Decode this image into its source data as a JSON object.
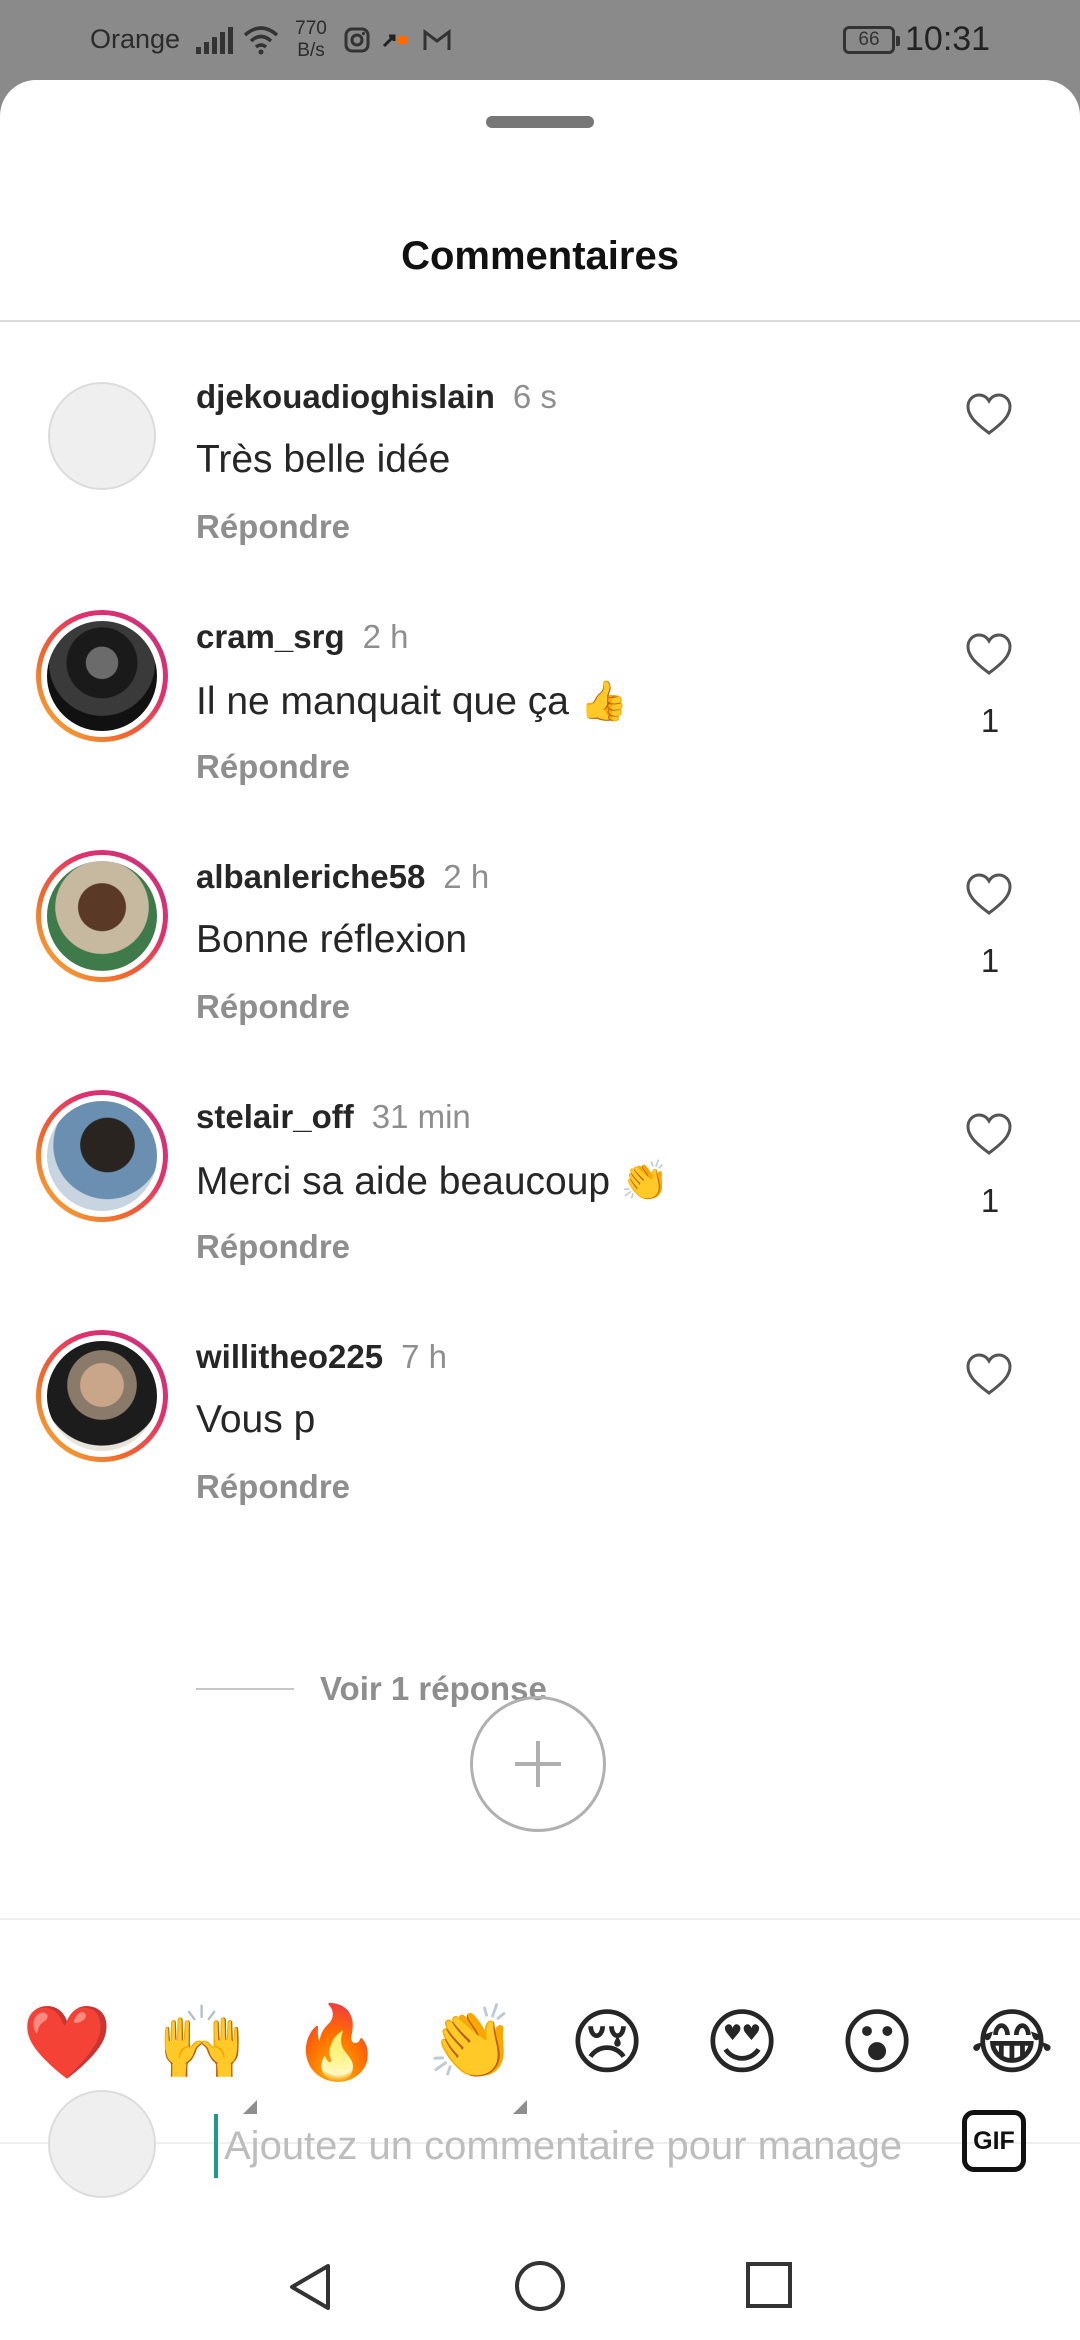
{
  "status_bar": {
    "carrier": "Orange",
    "net_speed_value": "770",
    "net_speed_unit": "B/s",
    "battery": "66",
    "time": "10:31",
    "notification_icons": [
      "instagram-icon",
      "orange-app-icon",
      "gmail-icon"
    ]
  },
  "sheet": {
    "title": "Commentaires"
  },
  "comments": [
    {
      "username": "djekouadioghislain",
      "time": "6 s",
      "text": "Très belle idée",
      "reply": "Répondre",
      "likes": "",
      "avatar": "placeholder"
    },
    {
      "username": "cram_srg",
      "time": "2 h",
      "text": "Il ne manquait que ça 👍",
      "reply": "Répondre",
      "likes": "1",
      "avatar": "story-ring"
    },
    {
      "username": "albanleriche58",
      "time": "2 h",
      "text": "Bonne réflexion",
      "reply": "Répondre",
      "likes": "1",
      "avatar": "story-ring"
    },
    {
      "username": "stelair_off",
      "time": "31 min",
      "text": "Merci sa aide beaucoup 👏",
      "reply": "Répondre",
      "likes": "1",
      "avatar": "story-ring"
    },
    {
      "username": "willitheo225",
      "time": "7 h",
      "text": "Vous p",
      "reply": "Répondre",
      "likes": "",
      "avatar": "story-ring"
    }
  ],
  "view_replies": "Voir 1 réponse",
  "emoji_bar": [
    "❤️",
    "🙌",
    "🔥",
    "👏",
    "😢",
    "😍",
    "😮",
    "😂"
  ],
  "composer": {
    "placeholder": "Ajoutez un commentaire pour manage",
    "gif_label": "GIF"
  },
  "colors": {
    "username": "#262626",
    "secondary_text": "#8e8e8e",
    "status_bar": "#8a8a8a",
    "story_ring_start": "#f9b73a",
    "story_ring_end": "#c13584"
  }
}
